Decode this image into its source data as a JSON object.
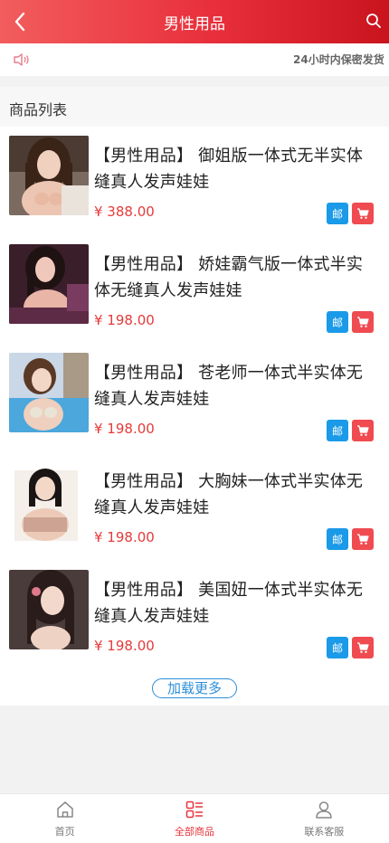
{
  "header": {
    "title": "男性用品",
    "back_icon": "chevron-left-icon",
    "search_icon": "search-icon",
    "gradient": [
      "#f25d5d",
      "#e82f3b",
      "#c9141e"
    ]
  },
  "notice": {
    "text": "24小时内保密发货",
    "icon": "speaker-icon"
  },
  "section": {
    "title": "商品列表"
  },
  "products": [
    {
      "name": "【男性用品】 御姐版一体式无半实体缝真人发声娃娃",
      "price": "¥ 388.00",
      "mail_label": "邮"
    },
    {
      "name": "【男性用品】 娇娃霸气版一体式半实体无缝真人发声娃娃",
      "price": "¥ 198.00",
      "mail_label": "邮"
    },
    {
      "name": "【男性用品】 苍老师一体式半实体无缝真人发声娃娃",
      "price": "¥ 198.00",
      "mail_label": "邮"
    },
    {
      "name": "【男性用品】 大胸妹一体式半实体无缝真人发声娃娃",
      "price": "¥ 198.00",
      "mail_label": "邮"
    },
    {
      "name": "【男性用品】 美国妞一体式半实体无缝真人发声娃娃",
      "price": "¥ 198.00",
      "mail_label": "邮"
    }
  ],
  "load_more": "加载更多",
  "tabbar": [
    {
      "label": "首页",
      "icon": "home-icon",
      "active": false
    },
    {
      "label": "全部商品",
      "icon": "category-icon",
      "active": true
    },
    {
      "label": "联系客服",
      "icon": "user-icon",
      "active": false
    }
  ],
  "colors": {
    "accent": "#e8343c",
    "mail": "#1a9ae8",
    "cart": "#ef4b50",
    "link": "#2c8fd8"
  }
}
